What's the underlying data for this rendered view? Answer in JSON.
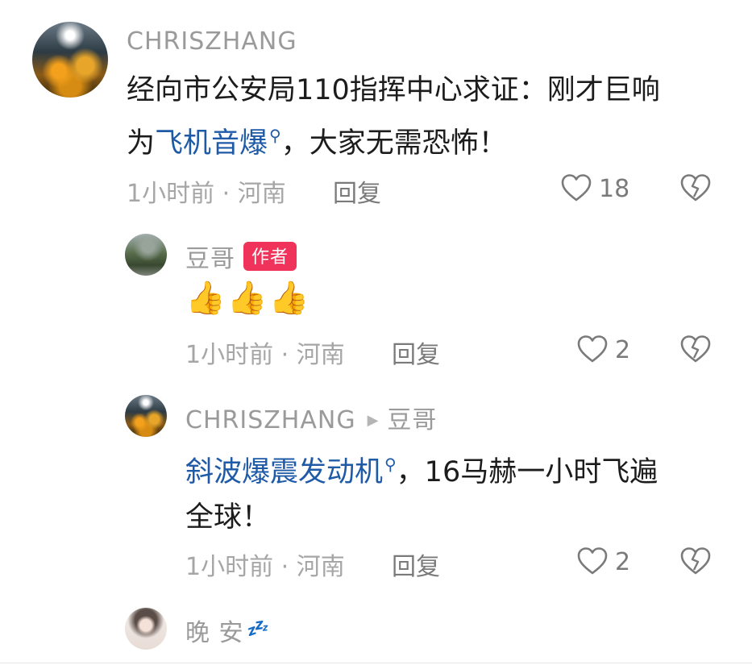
{
  "comments": [
    {
      "username": "CHRISZHANG",
      "content_prefix": "经向市公安局110指挥中心求证：刚才巨响",
      "content_line2_prefix": "为",
      "content_link": "飞机音爆",
      "content_suffix": "，大家无需恐怖！",
      "meta": "1小时前 · 河南",
      "reply_label": "回复",
      "likes": "18"
    }
  ],
  "replies": [
    {
      "username": "豆哥",
      "badge": "作者",
      "emoji": "👍",
      "meta": "1小时前 · 河南",
      "reply_label": "回复",
      "likes": "2"
    },
    {
      "username": "CHRISZHANG",
      "reply_to": "豆哥",
      "content_link": "斜波爆震发动机",
      "content_suffix": "，16马赫一小时飞遍",
      "content_line2": "全球！",
      "meta": "1小时前 · 河南",
      "reply_label": "回复",
      "likes": "2"
    },
    {
      "username": "晚 安",
      "username_emoji": "💤"
    }
  ],
  "colors": {
    "link": "#1f5aa6",
    "badge": "#f0335a",
    "meta": "#a6a6a6",
    "username": "#9a9a9a"
  },
  "icons": {
    "like": "heart-outline-icon",
    "dislike": "broken-heart-icon",
    "search_mark": "search-mark-icon",
    "reply_arrow": "triangle-right-icon"
  }
}
